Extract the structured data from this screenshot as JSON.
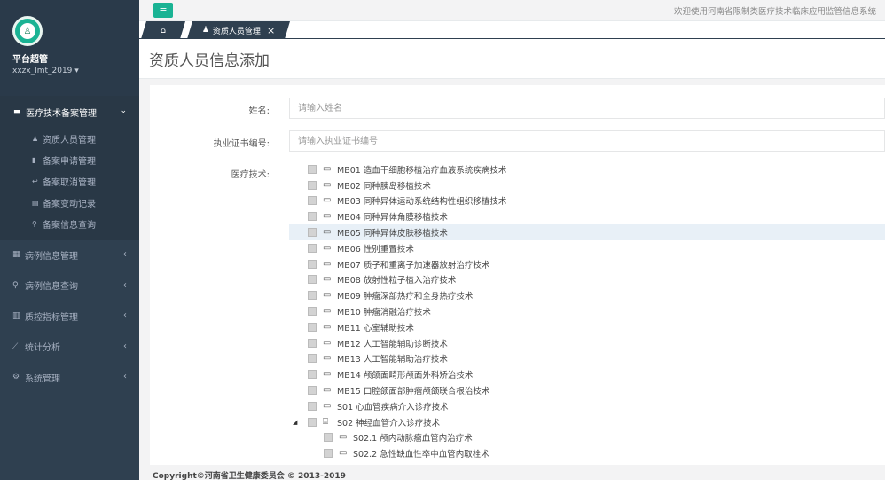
{
  "sidebar": {
    "role": "平台超管",
    "user": "xxzx_lmt_2019",
    "active_menu": "医疗技术备案管理",
    "sub_items": [
      {
        "icon": "user-icon",
        "glyph": "♟",
        "label": "资质人员管理"
      },
      {
        "icon": "bookmark-icon",
        "glyph": "▮",
        "label": "备案申请管理"
      },
      {
        "icon": "undo-icon",
        "glyph": "↩",
        "label": "备案取消管理"
      },
      {
        "icon": "file-icon",
        "glyph": "▤",
        "label": "备案变动记录"
      },
      {
        "icon": "search-icon",
        "glyph": "⚲",
        "label": "备案信息查询"
      }
    ],
    "menu_items": [
      {
        "icon": "grid-icon",
        "glyph": "▦",
        "label": "病例信息管理"
      },
      {
        "icon": "search-icon",
        "glyph": "⚲",
        "label": "病例信息查询"
      },
      {
        "icon": "bar-chart-icon",
        "glyph": "▥",
        "label": "质控指标管理"
      },
      {
        "icon": "line-chart-icon",
        "glyph": "⟋",
        "label": "统计分析"
      },
      {
        "icon": "gear-icon",
        "glyph": "⚙",
        "label": "系统管理"
      }
    ]
  },
  "topbar": {
    "welcome": "欢迎使用河南省限制类医疗技术临床应用监管信息系统"
  },
  "tabs": {
    "active": "资质人员管理"
  },
  "page": {
    "title": "资质人员信息添加"
  },
  "form": {
    "name_label": "姓名:",
    "name_placeholder": "请输入姓名",
    "cert_label": "执业证书编号:",
    "cert_placeholder": "请输入执业证书编号",
    "tech_label": "医疗技术:"
  },
  "tree": [
    {
      "label": "MB01 造血干细胞移植治疗血液系统疾病技术",
      "level": 0
    },
    {
      "label": "MB02 同种胰岛移植技术",
      "level": 0
    },
    {
      "label": "MB03 同种异体运动系统结构性组织移植技术",
      "level": 0
    },
    {
      "label": "MB04 同种异体角膜移植技术",
      "level": 0
    },
    {
      "label": "MB05 同种异体皮肤移植技术",
      "level": 0,
      "highlight": true
    },
    {
      "label": "MB06 性别重置技术",
      "level": 0
    },
    {
      "label": "MB07 质子和重离子加速器放射治疗技术",
      "level": 0
    },
    {
      "label": "MB08 放射性粒子植入治疗技术",
      "level": 0
    },
    {
      "label": "MB09 肿瘤深部热疗和全身热疗技术",
      "level": 0
    },
    {
      "label": "MB10 肿瘤消融治疗技术",
      "level": 0
    },
    {
      "label": "MB11 心室辅助技术",
      "level": 0
    },
    {
      "label": "MB12 人工智能辅助诊断技术",
      "level": 0
    },
    {
      "label": "MB13 人工智能辅助治疗技术",
      "level": 0
    },
    {
      "label": "MB14 颅颌面畸形颅面外科矫治技术",
      "level": 0
    },
    {
      "label": "MB15 口腔颌面部肿瘤颅颌联合根治技术",
      "level": 0
    },
    {
      "label": "S01 心血管疾病介入诊疗技术",
      "level": 0
    },
    {
      "label": "S02 神经血管介入诊疗技术",
      "level": 0,
      "expanded": true
    },
    {
      "label": "S02.1 颅内动脉瘤血管内治疗术",
      "level": 1
    },
    {
      "label": "S02.2 急性缺血性卒中血管内取栓术",
      "level": 1
    }
  ],
  "footer": {
    "copyright": "Copyright©河南省卫生健康委员会 © 2013-2019"
  }
}
